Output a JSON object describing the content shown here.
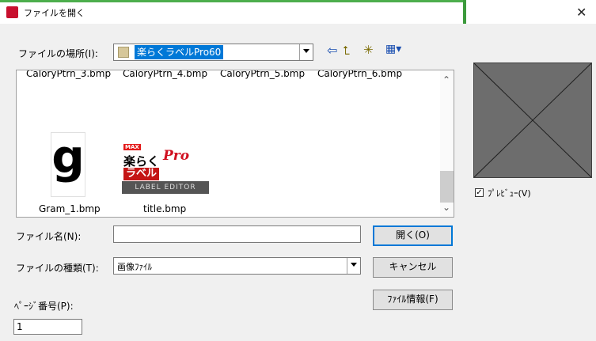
{
  "window": {
    "title": "ファイルを開く",
    "close_glyph": "✕"
  },
  "lookin": {
    "label": "ファイルの場所(I):",
    "value": "楽らくラベルPro60"
  },
  "toolbar": {
    "back_glyph": "⇦",
    "up_glyph": "⮤",
    "newfolder_glyph": "✳",
    "views_glyph": "▦▾"
  },
  "files": {
    "row_partial": [
      "CaloryPtrn_3.bmp",
      "CaloryPtrn_4.bmp",
      "CaloryPtrn_5.bmp",
      "CaloryPtrn_6.bmp"
    ],
    "items": [
      {
        "name": "Gram_1.bmp",
        "glyph": "g"
      },
      {
        "name": "title.bmp",
        "badge": "MAX",
        "line1": "楽らく",
        "pro": "Pro",
        "line2": "ラベル",
        "line3": "LABEL EDITOR"
      }
    ],
    "scroll_up_glyph": "⌃",
    "scroll_down_glyph": "⌄"
  },
  "filename": {
    "label": "ファイル名(N):",
    "value": ""
  },
  "filetype": {
    "label": "ファイルの種類(T):",
    "value": "画像ﾌｧｲﾙ"
  },
  "buttons": {
    "open": "開く(O)",
    "cancel": "キャンセル",
    "fileinfo": "ﾌｧｲﾙ情報(F)"
  },
  "page": {
    "label": "ﾍﾟｰｼﾞ番号(P):",
    "value": "1"
  },
  "preview": {
    "checkbox_label": "ﾌﾟﾚﾋﾞｭｰ(V)",
    "check_glyph": "✓"
  }
}
